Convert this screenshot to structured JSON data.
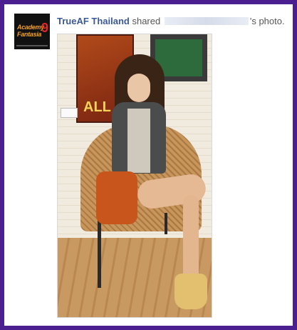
{
  "post": {
    "page_name": "TrueAF Thailand",
    "action_text": "shared",
    "suffix_text": "'s photo.",
    "avatar": {
      "logo_text": "Academy Fantasia",
      "logo_number": "9"
    },
    "photo": {
      "poster_text": "ALL"
    }
  },
  "colors": {
    "frame": "#4b1f8f",
    "link": "#3b5998"
  }
}
